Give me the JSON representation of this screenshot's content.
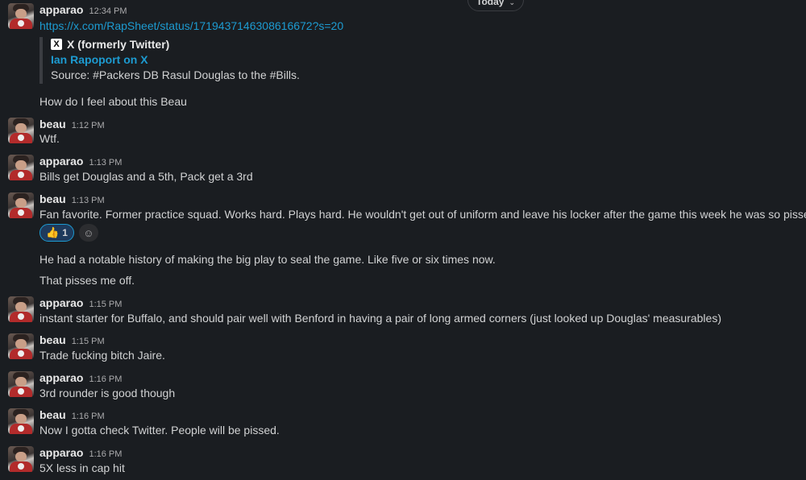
{
  "divider": {
    "label": "Today"
  },
  "messages": [
    {
      "author": "apparao",
      "time": "12:34 PM",
      "link": "https://x.com/RapSheet/status/1719437146308616672?s=20",
      "unfurl": {
        "source": "X (formerly Twitter)",
        "title": "Ian Rapoport on X",
        "body": "Source: #Packers DB Rasul Douglas to the #Bills."
      },
      "followups": [
        "How do I feel about this Beau"
      ]
    },
    {
      "author": "beau",
      "time": "1:12 PM",
      "text": "Wtf."
    },
    {
      "author": "apparao",
      "time": "1:13 PM",
      "text": "Bills get Douglas and a 5th, Pack get a 3rd"
    },
    {
      "author": "beau",
      "time": "1:13 PM",
      "text": "Fan favorite.  Former practice squad. Works hard.  Plays hard.   He wouldn't get out of uniform and leave his locker after the game this week he was so pissed.",
      "reactions": [
        {
          "emoji": "thumbs-up",
          "count": "1"
        }
      ],
      "followups": [
        "He had a notable history of making the big play to seal the game.  Like five or six times now.",
        "That pisses me off."
      ]
    },
    {
      "author": "apparao",
      "time": "1:15 PM",
      "text": "instant starter for Buffalo, and should pair well with Benford in having a pair of long armed corners (just looked up Douglas' measurables)"
    },
    {
      "author": "beau",
      "time": "1:15 PM",
      "text": "Trade fucking bitch Jaire."
    },
    {
      "author": "apparao",
      "time": "1:16 PM",
      "text": "3rd rounder is good though"
    },
    {
      "author": "beau",
      "time": "1:16 PM",
      "text": "Now I gotta check Twitter.  People will be pissed."
    },
    {
      "author": "apparao",
      "time": "1:16 PM",
      "text": "5X less in cap hit"
    }
  ]
}
